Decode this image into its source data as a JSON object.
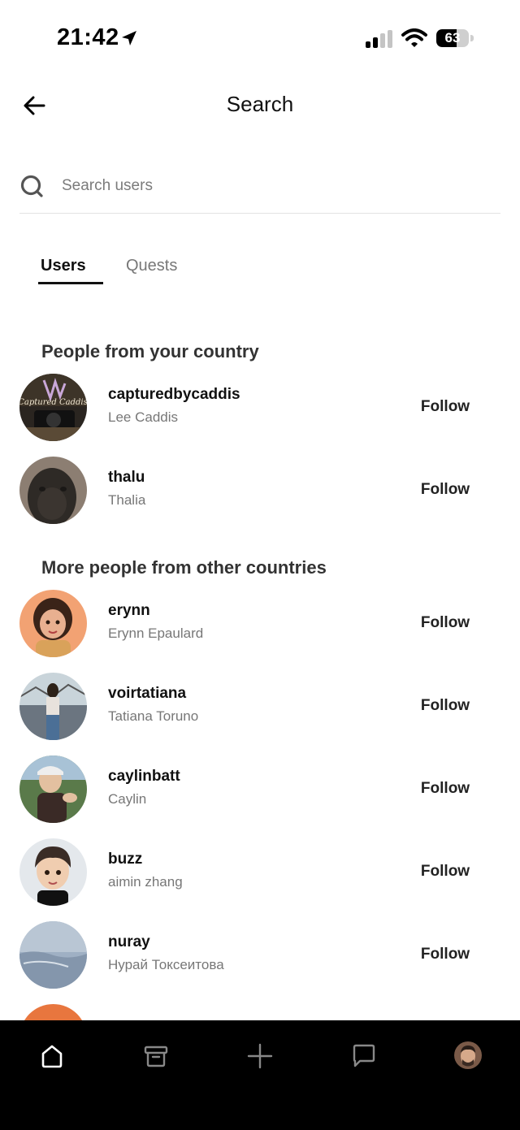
{
  "status_bar": {
    "time": "21:42",
    "battery_level": "63",
    "battery_fraction": 0.63
  },
  "header": {
    "title": "Search",
    "back_icon": "arrow-left-icon"
  },
  "search": {
    "placeholder": "Search users",
    "value": "",
    "icon": "search-icon"
  },
  "tabs": [
    {
      "label": "Users",
      "active": true
    },
    {
      "label": "Quests",
      "active": false
    }
  ],
  "sections": {
    "country": {
      "title": "People from your country",
      "users": [
        {
          "username": "capturedbycaddis",
          "name": "Lee Caddis",
          "follow_label": "Follow"
        },
        {
          "username": "thalu",
          "name": "Thalia",
          "follow_label": "Follow"
        }
      ]
    },
    "other": {
      "title": "More people from other countries",
      "users": [
        {
          "username": "erynn",
          "name": "Erynn Epaulard",
          "follow_label": "Follow"
        },
        {
          "username": "voirtatiana",
          "name": "Tatiana Toruno",
          "follow_label": "Follow"
        },
        {
          "username": "caylinbatt",
          "name": "Caylin",
          "follow_label": "Follow"
        },
        {
          "username": "buzz",
          "name": "aimin zhang",
          "follow_label": "Follow"
        },
        {
          "username": "nuray",
          "name": "Нурай Токсеитова",
          "follow_label": "Follow"
        }
      ]
    }
  },
  "bottom_nav": {
    "items": [
      "home-icon",
      "archive-icon",
      "plus-icon",
      "chat-icon",
      "profile-avatar"
    ]
  },
  "colors": {
    "text_primary": "#111111",
    "text_secondary": "#777777",
    "nav_background": "#000000",
    "divider": "#e3e3e3"
  }
}
